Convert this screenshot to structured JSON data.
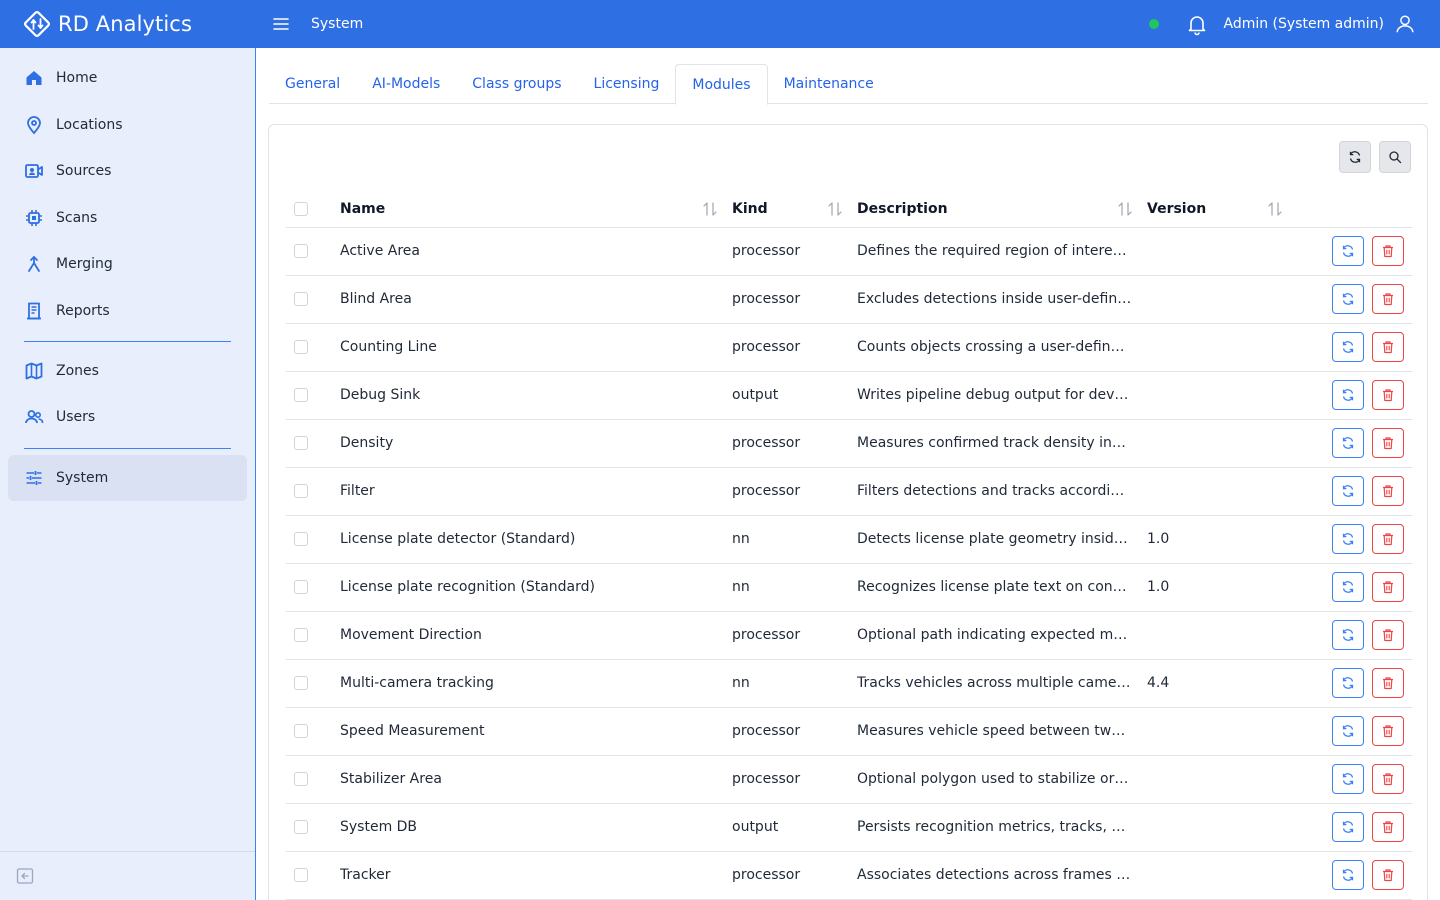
{
  "app": {
    "brand": "RD Analytics",
    "page_title": "System",
    "user": "Admin (System admin)",
    "accent": "#2f6fe4",
    "status_color": "#22c55e"
  },
  "sidebar": {
    "items": [
      {
        "label": "Home",
        "icon": "home-icon"
      },
      {
        "label": "Locations",
        "icon": "map-pin-icon"
      },
      {
        "label": "Sources",
        "icon": "camera-icon"
      },
      {
        "label": "Scans",
        "icon": "chip-icon"
      },
      {
        "label": "Merging",
        "icon": "merge-icon"
      },
      {
        "label": "Reports",
        "icon": "report-icon"
      },
      {
        "label": "Zones",
        "icon": "map-icon"
      },
      {
        "label": "Users",
        "icon": "users-icon"
      },
      {
        "label": "System",
        "icon": "sliders-icon"
      }
    ]
  },
  "tabs": [
    "General",
    "AI-Models",
    "Class groups",
    "Licensing",
    "Modules",
    "Maintenance"
  ],
  "active_tab": "Modules",
  "table": {
    "headers": {
      "name": "Name",
      "kind": "Kind",
      "description": "Description",
      "version": "Version"
    },
    "rows": [
      {
        "name": "Active Area",
        "kind": "processor",
        "description": "Defines the required region of interest ...",
        "version": ""
      },
      {
        "name": "Blind Area",
        "kind": "processor",
        "description": "Excludes detections inside user-define...",
        "version": ""
      },
      {
        "name": "Counting Line",
        "kind": "processor",
        "description": "Counts objects crossing a user-defined...",
        "version": ""
      },
      {
        "name": "Debug Sink",
        "kind": "output",
        "description": "Writes pipeline debug output for devel...",
        "version": ""
      },
      {
        "name": "Density",
        "kind": "processor",
        "description": "Measures confirmed track density insi...",
        "version": ""
      },
      {
        "name": "Filter",
        "kind": "processor",
        "description": "Filters detections and tracks according ...",
        "version": ""
      },
      {
        "name": "License plate detector (Standard)",
        "kind": "nn",
        "description": "Detects license plate geometry inside ...",
        "version": "1.0"
      },
      {
        "name": "License plate recognition (Standard)",
        "kind": "nn",
        "description": "Recognizes license plate text on confir...",
        "version": "1.0"
      },
      {
        "name": "Movement Direction",
        "kind": "processor",
        "description": "Optional path indicating expected mov...",
        "version": ""
      },
      {
        "name": "Multi-camera tracking",
        "kind": "nn",
        "description": "Tracks vehicles across multiple camera...",
        "version": "4.4"
      },
      {
        "name": "Speed Measurement",
        "kind": "processor",
        "description": "Measures vehicle speed between two r...",
        "version": ""
      },
      {
        "name": "Stabilizer Area",
        "kind": "processor",
        "description": "Optional polygon used to stabilize or c...",
        "version": ""
      },
      {
        "name": "System DB",
        "kind": "output",
        "description": "Persists recognition metrics, tracks, an...",
        "version": ""
      },
      {
        "name": "Tracker",
        "kind": "processor",
        "description": "Associates detections across frames a...",
        "version": ""
      }
    ]
  }
}
